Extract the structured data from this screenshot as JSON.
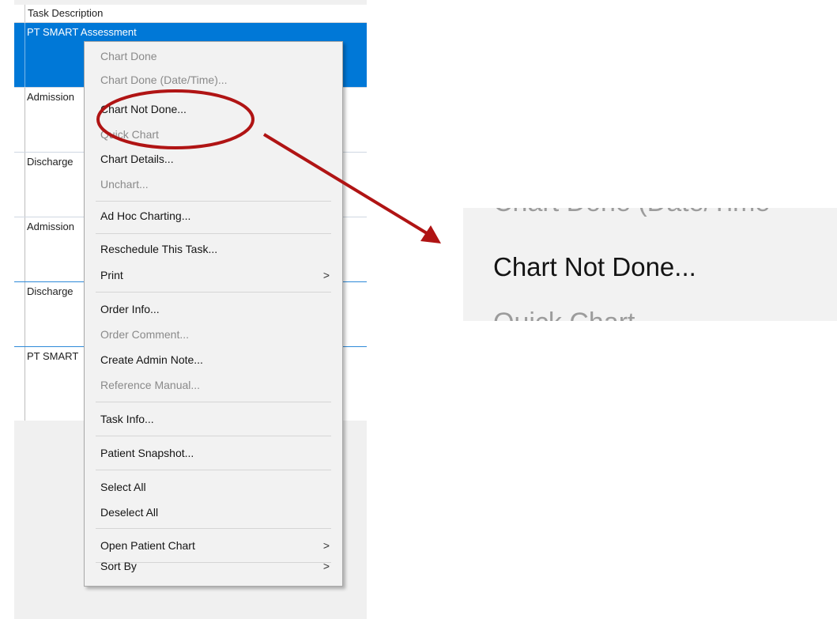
{
  "task_list": {
    "column_header": "Task Description",
    "rows": [
      {
        "label": "PT SMART Assessment",
        "selected": true
      },
      {
        "label": "Admission"
      },
      {
        "label": "Discharge"
      },
      {
        "label": "Admission"
      },
      {
        "label": "Discharge"
      },
      {
        "label": "PT SMART"
      }
    ]
  },
  "context_menu": {
    "items": [
      {
        "label": "Chart Done",
        "enabled": false
      },
      {
        "label": "Chart Done (Date/Time)...",
        "enabled": false
      },
      {
        "label": "Chart Not Done...",
        "enabled": true,
        "highlighted": true
      },
      {
        "label": "Quick Chart",
        "enabled": false
      },
      {
        "label": "Chart Details...",
        "enabled": true
      },
      {
        "label": "Unchart...",
        "enabled": false
      },
      {
        "label": "Ad Hoc Charting...",
        "enabled": true
      },
      {
        "label": "Reschedule This Task...",
        "enabled": true
      },
      {
        "label": "Print",
        "enabled": true,
        "submenu": true
      },
      {
        "label": "Order Info...",
        "enabled": true
      },
      {
        "label": "Order Comment...",
        "enabled": false
      },
      {
        "label": "Create Admin Note...",
        "enabled": true
      },
      {
        "label": "Reference Manual...",
        "enabled": false
      },
      {
        "label": "Task Info...",
        "enabled": true
      },
      {
        "label": "Patient Snapshot...",
        "enabled": true
      },
      {
        "label": "Select All",
        "enabled": true
      },
      {
        "label": "Deselect All",
        "enabled": true
      },
      {
        "label": "Open Patient Chart",
        "enabled": true,
        "submenu": true
      },
      {
        "label": "Sort By",
        "enabled": true,
        "submenu": true
      }
    ],
    "submenu_glyph": ">"
  },
  "zoom_callout": {
    "top_partial": "Chart Done (Date/Time",
    "main": "Chart Not Done...",
    "bottom_partial": "Quick Chart"
  },
  "colors": {
    "selection_blue": "#0078d7",
    "annotation_red": "#b01414",
    "disabled_text": "#8a8a8a"
  }
}
